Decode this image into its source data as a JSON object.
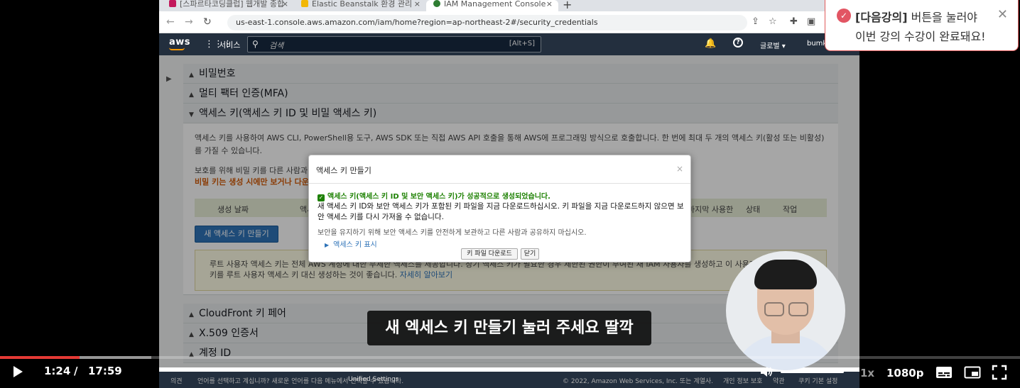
{
  "browser": {
    "tabs": [
      {
        "label": "[스파르타코딩클럽] 웹개발 종합",
        "favicon_color": "#c2185b"
      },
      {
        "label": "Elastic Beanstalk 환경 관리",
        "favicon_color": "#f2b705"
      },
      {
        "label": "IAM Management Console",
        "favicon_color": "#2e7d32"
      }
    ],
    "new_tab_label": "+",
    "url": "us-east-1.console.aws.amazon.com/iam/home?region=ap-northeast-2#/security_credentials"
  },
  "aws_nav": {
    "logo": "aws",
    "services_label": "서비스",
    "search_placeholder": "검색",
    "search_shortcut": "[Alt+S]",
    "region_label": "글로벌 ▾",
    "user_label": "bumk"
  },
  "sections": {
    "password": "비밀번호",
    "mfa": "멀티 팩터 인증(MFA)",
    "access_keys": "액세스 키(액세스 키 ID 및 비밀 액세스 키)",
    "cloudfront": "CloudFront 키 페어",
    "x509": "X.509 인증서",
    "account_id": "계정 ID"
  },
  "access_keys_panel": {
    "description": "액세스 키를 사용하여 AWS CLI, PowerShell용 도구, AWS SDK 또는 직접 AWS API 호출을 통해 AWS에 프로그래밍 방식으로 호출합니다. 한 번에 최대 두 개의 액세스 키(활성 또는 비활성)를 가질 수 있습니다.",
    "note_1": "보호를 위해 비밀 키를 다른 사람과 공유하지 마십시오.",
    "note_2": "비밀 키는 생성 시에만 보거나 다운로드할 수 있습니다.",
    "table_headers": [
      "생성 날짜",
      "액세스 키 ID",
      "마지막 사용한",
      "상태",
      "작업"
    ],
    "create_button": "새 액세스 키 만들기",
    "root_notice": "루트 사용자 액세스 키는 전체 AWS 계정에 대한 무제한 액세스를 제공합니다. 장기 액세스 키가 필요한 경우 제한된 권한이 부여된 새 IAM 사용자를 생성하고 이 사용자에 대한 액세스 키를 루트 사용자 액세스 키 대신 생성하는 것이 좋습니다.",
    "root_link": "자세히 알아보기"
  },
  "modal": {
    "title": "액세스 키 만들기",
    "close": "×",
    "success": "액세스 키(액세스 키 ID 및 보안 액세스 키)가 성공적으로 생성되었습니다.",
    "message": "새 액세스 키 ID와 보안 액세스 키가 포함된 키 파일을 지금 다운로드하십시오. 키 파일을 지금 다운로드하지 않으면 보안 액세스 키를 다시 가져올 수 없습니다.",
    "tip": "보안을 유지하기 위해 보안 액세스 키를 안전하게 보관하고 다른 사람과 공유하지 마십시오.",
    "show_key": "액세스 키 표시",
    "download_button": "키 파일 다운로드",
    "close_button": "닫기"
  },
  "aws_footer": {
    "feedback": "의견",
    "language_notice": "언어를 선택하고 계십니까? 새로운 언어를 다음 메뉴에서 선택할 수 있습니다.",
    "unified_settings": "Unified Settings",
    "copyright": "© 2022, Amazon Web Services, Inc. 또는 계열사.",
    "privacy": "개인 정보 보호",
    "terms": "약관",
    "cookies": "쿠키 기본 설정"
  },
  "toast": {
    "highlight": "[다음강의]",
    "line_1_rest": " 버튼을 눌러야",
    "line_2": "이번 강의 수강이 완료돼요!",
    "close": "✕"
  },
  "subtitle": "새 엑세스 키 만들기 눌러 주세요 딸깍",
  "player": {
    "time_current": "1:24",
    "time_separator": "/",
    "time_total": "17:59",
    "progress_played_fraction": 0.0778,
    "progress_buffered_fraction": 0.148,
    "volume_fraction": 1.0,
    "speed": "1x",
    "quality": "1080p"
  },
  "colors": {
    "progress": "#e53935",
    "aws_nav": "#232f3e",
    "aws_primary": "#2e73b8",
    "success": "#1d8102",
    "toast_accent": "#e25563"
  }
}
